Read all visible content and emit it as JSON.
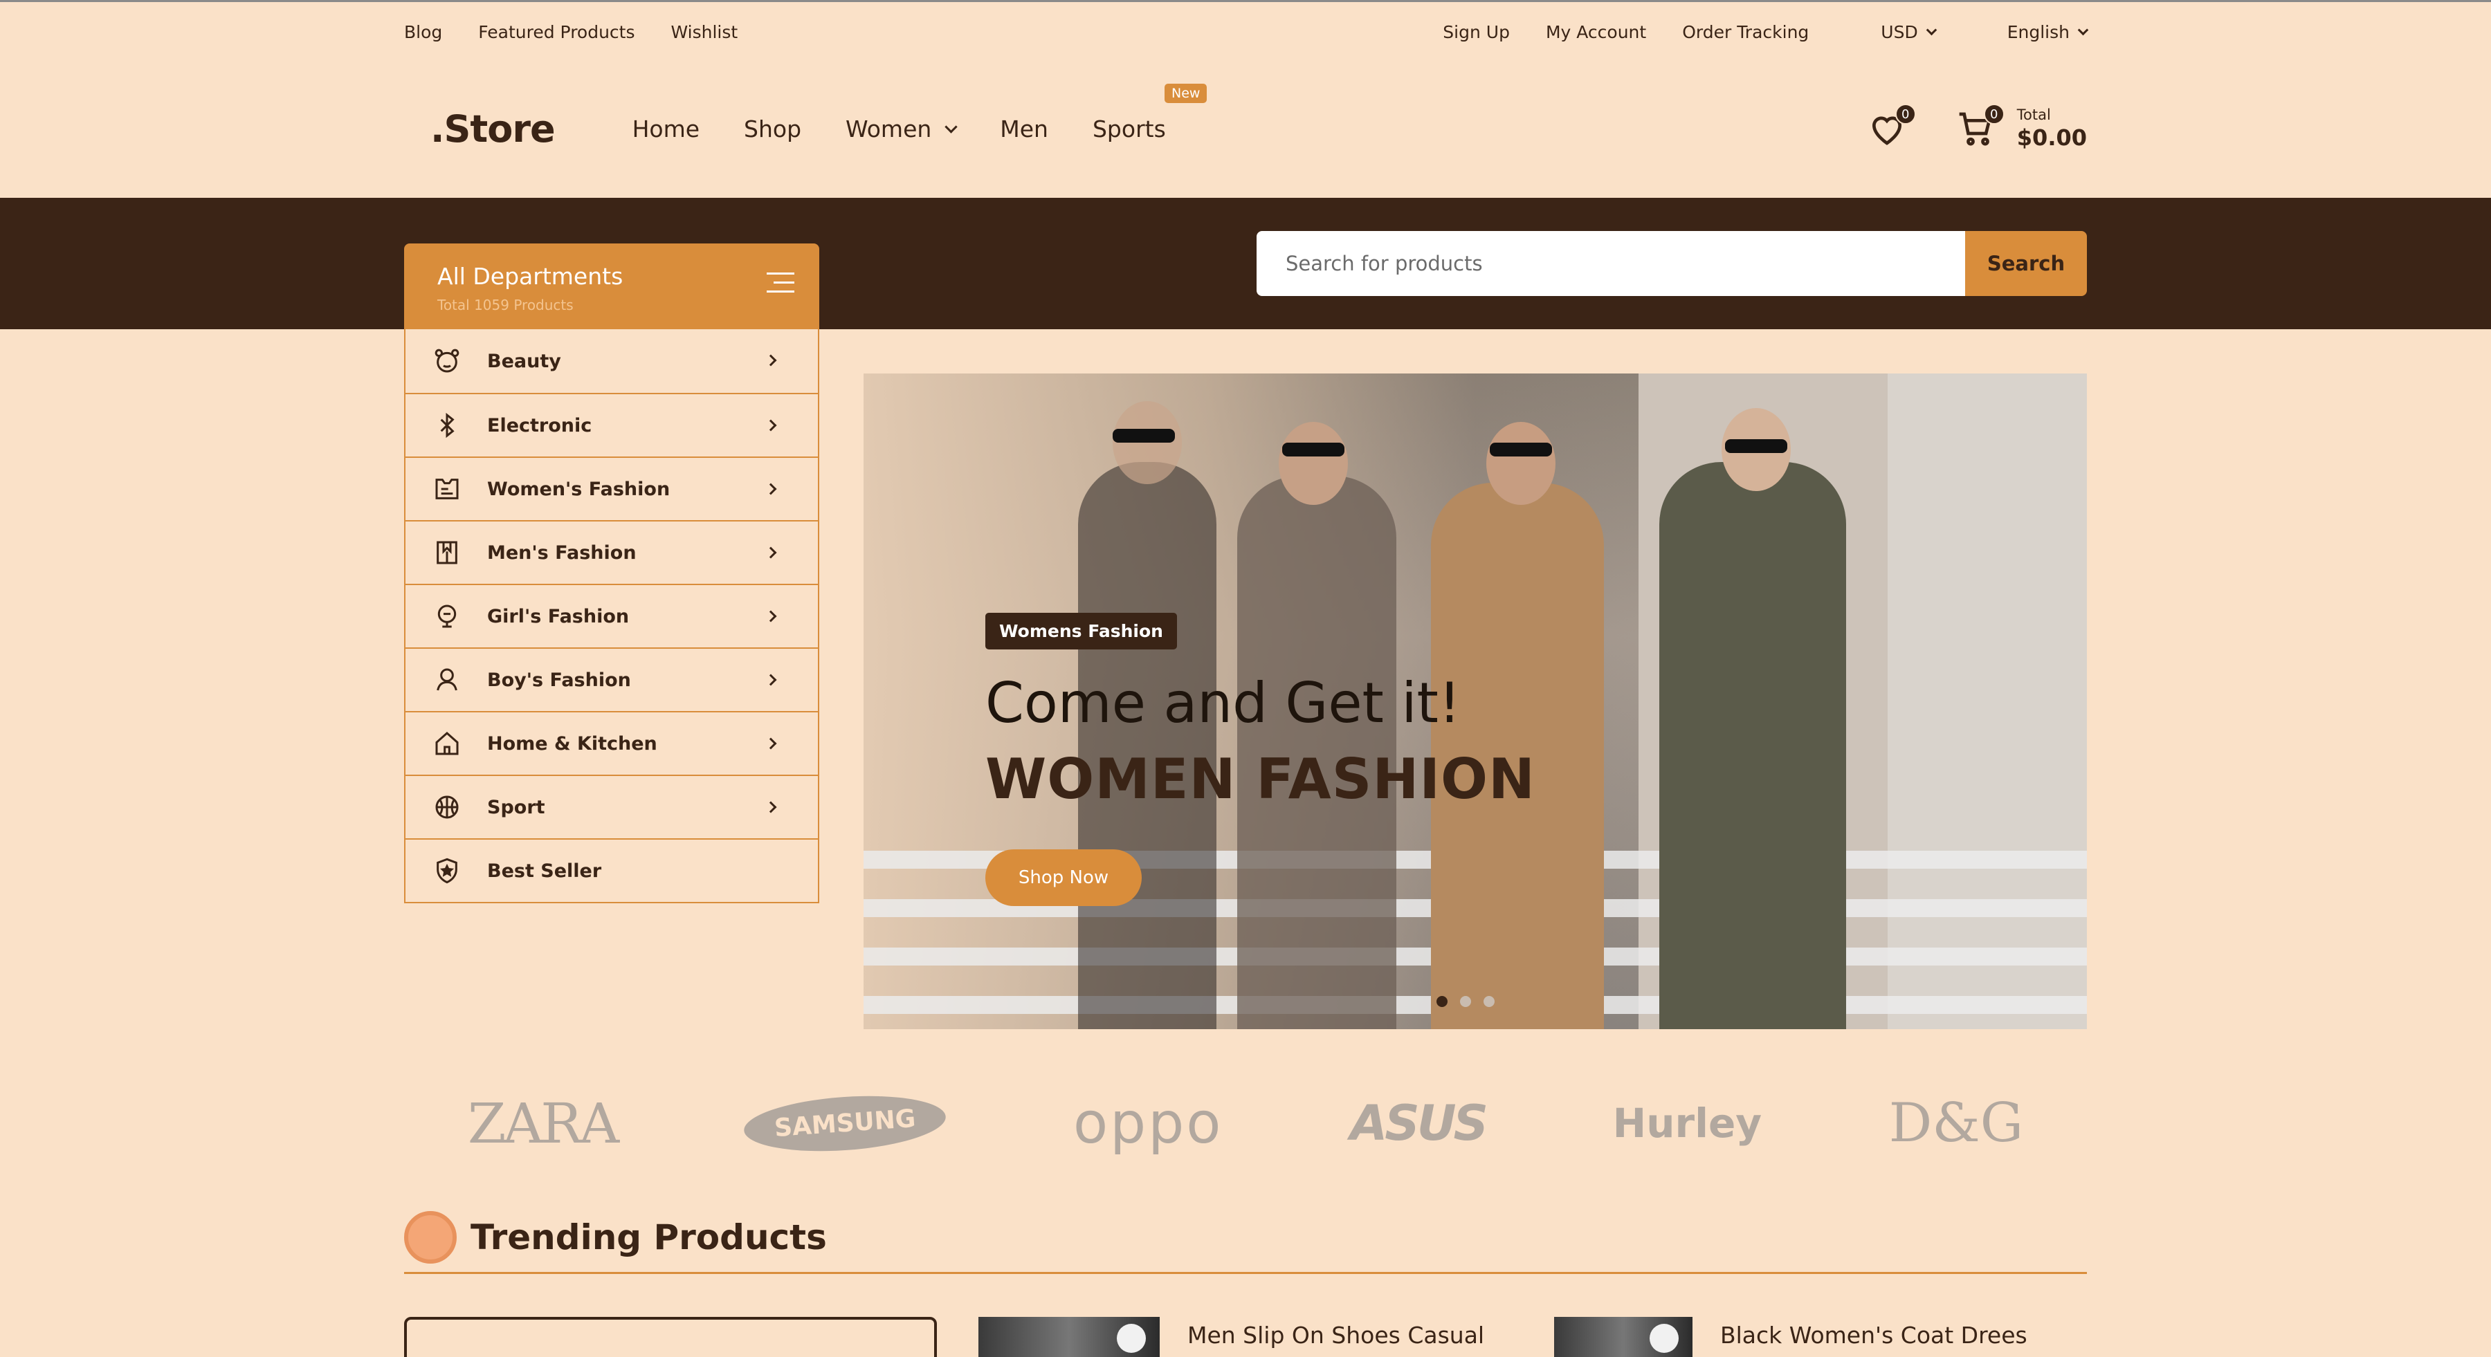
{
  "topbar": {
    "left": [
      "Blog",
      "Featured Products",
      "Wishlist"
    ],
    "right": [
      "Sign Up",
      "My Account",
      "Order Tracking"
    ],
    "currency": "USD",
    "language": "English"
  },
  "header": {
    "logo": ".Store",
    "nav": [
      "Home",
      "Shop",
      "Women",
      "Men",
      "Sports"
    ],
    "new_badge": "New",
    "wishlist_count": "0",
    "cart_count": "0",
    "total_label": "Total",
    "total_amount": "$0.00"
  },
  "departments": {
    "title": "All Departments",
    "subtitle": "Total 1059 Products",
    "items": [
      {
        "label": "Beauty",
        "icon": "bear-icon"
      },
      {
        "label": "Electronic",
        "icon": "bluetooth-icon"
      },
      {
        "label": "Women's Fashion",
        "icon": "shirt-icon"
      },
      {
        "label": "Men's Fashion",
        "icon": "suit-icon"
      },
      {
        "label": "Girl's Fashion",
        "icon": "girl-icon"
      },
      {
        "label": "Boy's Fashion",
        "icon": "boy-icon"
      },
      {
        "label": "Home & Kitchen",
        "icon": "home-icon"
      },
      {
        "label": "Sport",
        "icon": "basketball-icon"
      },
      {
        "label": "Best Seller",
        "icon": "shield-star-icon"
      }
    ]
  },
  "search": {
    "placeholder": "Search for products",
    "button": "Search"
  },
  "hero": {
    "tag": "Womens Fashion",
    "line1": "Come and Get it!",
    "line2": "WOMEN FASHION",
    "button": "Shop Now"
  },
  "brands": [
    "ZARA",
    "SAMSUNG",
    "oppo",
    "ASUS",
    "Hurley",
    "D&G"
  ],
  "trending": {
    "title": "Trending Products",
    "products": [
      "Men Slip On Shoes Casual With",
      "Black Women's Coat Drees"
    ]
  },
  "colors": {
    "background": "#fae1c8",
    "dark": "#3b2416",
    "accent": "#d98d3b"
  }
}
